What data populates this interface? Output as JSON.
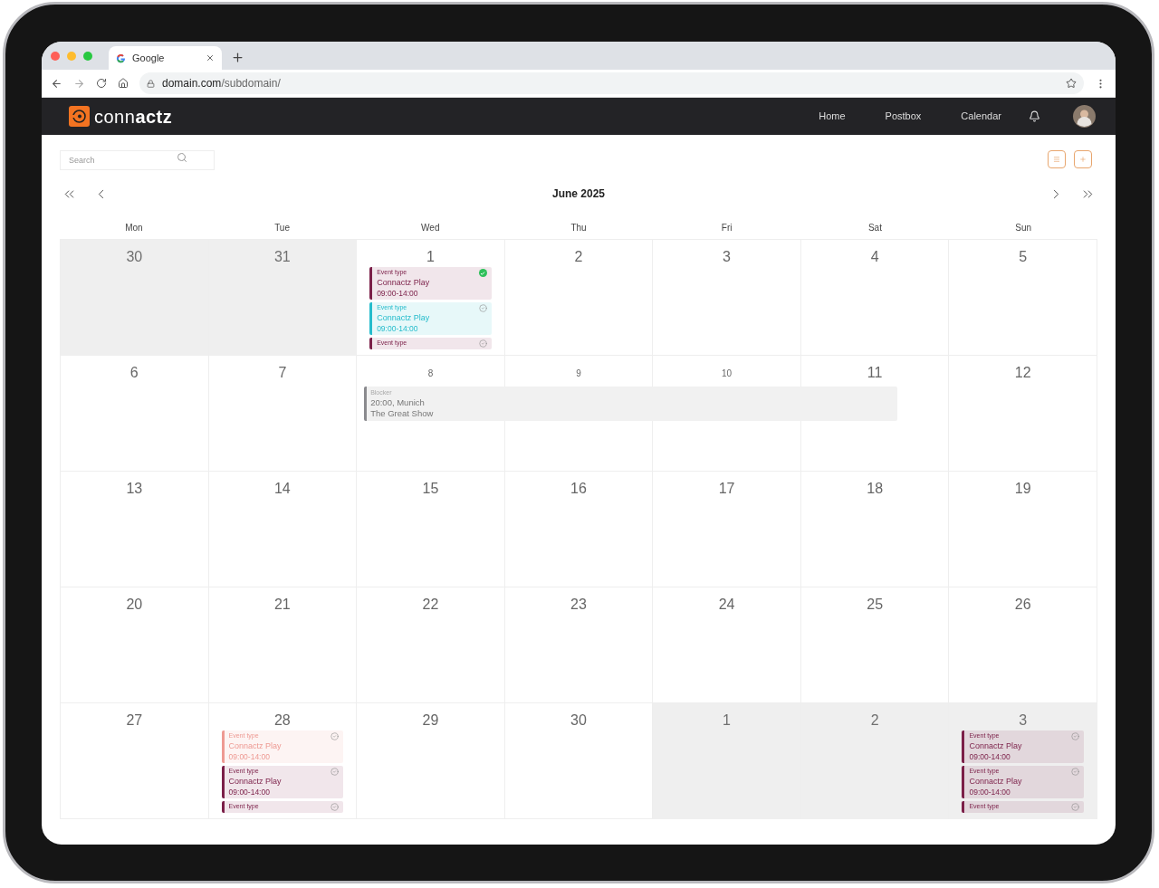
{
  "browser": {
    "tab_title": "Google",
    "url_domain": "domain.com",
    "url_path": "/subdomain/"
  },
  "app": {
    "logo": "conn**actz**",
    "nav": [
      "Home",
      "Postbox",
      "Calendar"
    ]
  },
  "toolbar": {
    "search": {
      "placeholder": "Search"
    },
    "month": "June 2025"
  },
  "weekdays": [
    "Mon",
    "Tue",
    "Wed",
    "Thu",
    "Fri",
    "Sat",
    "Sun"
  ],
  "weeks": [
    {
      "days": [
        {
          "number": "30",
          "outside": true,
          "blocked": false
        },
        {
          "number": "31",
          "outside": true,
          "blocked": false
        },
        {
          "number": "1",
          "outside": false,
          "blocked": false,
          "events": [
            {
              "type_label": "Event type",
              "title": "Connactz Play",
              "time": "09:00-14:00",
              "color": "#7b1f48",
              "confirmed": true
            },
            {
              "type_label": "Event type",
              "title": "Connactz Play",
              "time": "09:00-14:00",
              "color": "#25bccc",
              "confirmed": false
            },
            {
              "type_label": "Event type",
              "color": "#7b1f48",
              "confirmed": false
            }
          ]
        },
        {
          "number": "2",
          "outside": false,
          "blocked": false
        },
        {
          "number": "3",
          "outside": false,
          "blocked": false
        },
        {
          "number": "4",
          "outside": false,
          "blocked": false
        },
        {
          "number": "5",
          "outside": false,
          "blocked": false
        }
      ]
    },
    {
      "days": [
        {
          "number": "6",
          "outside": false,
          "blocked": false
        },
        {
          "number": "7",
          "outside": false,
          "blocked": false
        },
        {
          "number": "8",
          "outside": false,
          "blocked": true
        },
        {
          "number": "9",
          "outside": false,
          "blocked": true
        },
        {
          "number": "10",
          "outside": false,
          "blocked": true
        },
        {
          "number": "11",
          "outside": false,
          "blocked": false
        },
        {
          "number": "12",
          "outside": false,
          "blocked": false
        }
      ],
      "blocker": {
        "label": "Blocker",
        "lines": [
          "20:00, Munich",
          "The Great Show"
        ],
        "color": "#8a8a8e"
      }
    },
    {
      "days": [
        {
          "number": "13",
          "outside": false,
          "blocked": false
        },
        {
          "number": "14",
          "outside": false,
          "blocked": false
        },
        {
          "number": "15",
          "outside": false,
          "blocked": false
        },
        {
          "number": "16",
          "outside": false,
          "blocked": false
        },
        {
          "number": "17",
          "outside": false,
          "blocked": false
        },
        {
          "number": "18",
          "outside": false,
          "blocked": false
        },
        {
          "number": "19",
          "outside": false,
          "blocked": false
        }
      ]
    },
    {
      "days": [
        {
          "number": "20",
          "outside": false,
          "blocked": false
        },
        {
          "number": "21",
          "outside": false,
          "blocked": false
        },
        {
          "number": "22",
          "outside": false,
          "blocked": false
        },
        {
          "number": "23",
          "outside": false,
          "blocked": false
        },
        {
          "number": "24",
          "outside": false,
          "blocked": false
        },
        {
          "number": "25",
          "outside": false,
          "blocked": false
        },
        {
          "number": "26",
          "outside": false,
          "blocked": false
        }
      ]
    },
    {
      "days": [
        {
          "number": "27",
          "outside": false,
          "blocked": false
        },
        {
          "number": "28",
          "outside": false,
          "blocked": false,
          "events": [
            {
              "type_label": "Event type",
              "title": "Connactz Play",
              "time": "09:00-14:00",
              "color": "#ee9a93",
              "confirmed": false
            },
            {
              "type_label": "Event type",
              "title": "Connactz Play",
              "time": "09:00-14:00",
              "color": "#7b1f48",
              "confirmed": false
            },
            {
              "type_label": "Event type",
              "color": "#7b1f48",
              "confirmed": false
            }
          ]
        },
        {
          "number": "29",
          "outside": false,
          "blocked": false
        },
        {
          "number": "30",
          "outside": false,
          "blocked": false
        },
        {
          "number": "1",
          "outside": true,
          "blocked": false
        },
        {
          "number": "2",
          "outside": true,
          "blocked": false
        },
        {
          "number": "3",
          "outside": true,
          "blocked": false,
          "events": [
            {
              "type_label": "Event type",
              "title": "Connactz Play",
              "time": "09:00-14:00",
              "color": "#7b1f48",
              "confirmed": false
            },
            {
              "type_label": "Event type",
              "title": "Connactz Play",
              "time": "09:00-14:00",
              "color": "#7b1f48",
              "confirmed": false
            },
            {
              "type_label": "Event type",
              "color": "#7b1f48",
              "confirmed": false
            }
          ]
        }
      ]
    }
  ]
}
